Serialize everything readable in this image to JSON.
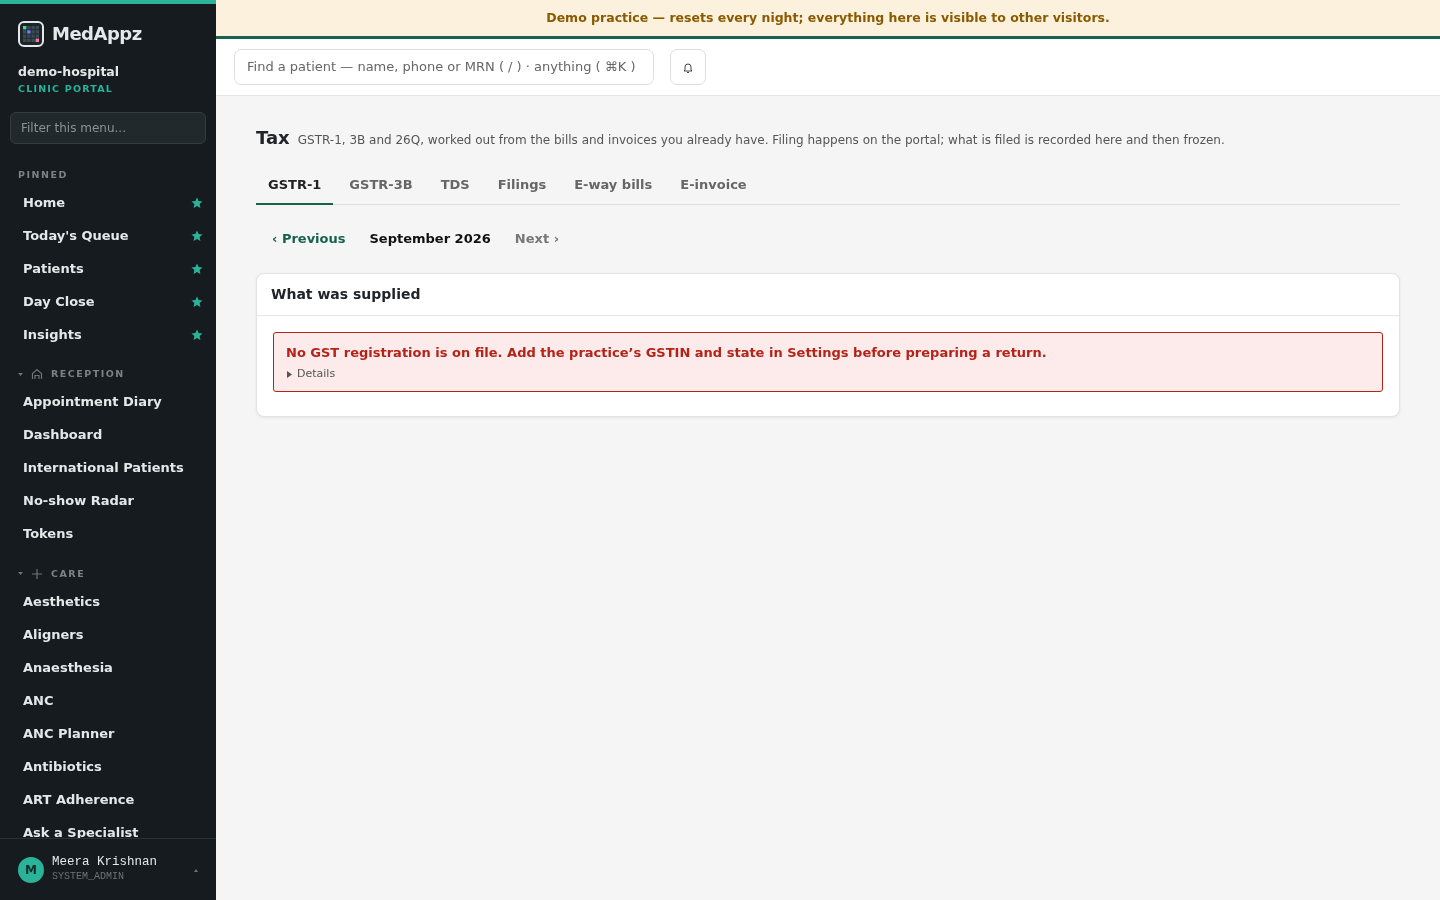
{
  "brand": {
    "name": "MedAppz",
    "org": "demo-hospital",
    "portal": "CLINIC PORTAL"
  },
  "sidebar": {
    "filter_placeholder": "Filter this menu...",
    "pinned": {
      "title": "PINNED",
      "items": [
        "Home",
        "Today's Queue",
        "Patients",
        "Day Close",
        "Insights"
      ]
    },
    "groups": [
      {
        "title": "RECEPTION",
        "expanded": true,
        "items": [
          "Appointment Diary",
          "Dashboard",
          "International Patients",
          "No-show Radar",
          "Tokens"
        ]
      },
      {
        "title": "CARE",
        "expanded": true,
        "items": [
          "Aesthetics",
          "Aligners",
          "Anaesthesia",
          "ANC",
          "ANC Planner",
          "Antibiotics",
          "ART Adherence",
          "Ask a Specialist"
        ]
      }
    ]
  },
  "user": {
    "initial": "M",
    "name": "Meera Krishnan",
    "role": "SYSTEM_ADMIN"
  },
  "banner": "Demo practice — resets every night; everything here is visible to other visitors.",
  "search": {
    "placeholder": "Find a patient — name, phone or MRN ( / ) · anything ( ⌘K )"
  },
  "page": {
    "title": "Tax",
    "subtitle": "GSTR-1, 3B and 26Q, worked out from the bills and invoices you already have. Filing happens on the portal; what is filed is recorded here and then frozen."
  },
  "tabs": [
    {
      "label": "GSTR-1",
      "selected": true
    },
    {
      "label": "GSTR-3B",
      "selected": false
    },
    {
      "label": "TDS",
      "selected": false
    },
    {
      "label": "Filings",
      "selected": false
    },
    {
      "label": "E-way bills",
      "selected": false
    },
    {
      "label": "E-invoice",
      "selected": false
    }
  ],
  "period": {
    "previous": "‹ Previous",
    "current": "September 2026",
    "next": "Next ›"
  },
  "card": {
    "title": "What was supplied",
    "alert": {
      "message": "No GST registration is on file. Add the practice’s GSTIN and state in Settings before preparing a return.",
      "details": "Details",
      "expanded": false
    }
  }
}
